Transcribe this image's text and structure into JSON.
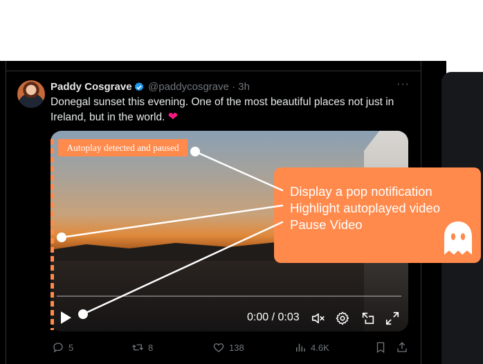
{
  "tweet": {
    "author_name": "Paddy Cosgrave",
    "handle_time": "@paddycosgrave · 3h",
    "more_glyph": "···",
    "text": "Donegal sunset this evening. One of the most beautiful places not just in Ireland, but in the world.",
    "heart_glyph": "❤"
  },
  "video": {
    "notice": "Autoplay detected and paused",
    "time": "0:00 / 0:03",
    "play_icon": "play-icon",
    "mute_icon": "muted-speaker-icon",
    "settings_icon": "gear-icon",
    "pip_icon": "picture-in-picture-icon",
    "fullscreen_icon": "expand-icon"
  },
  "popup": {
    "lines": [
      "Display a pop notification",
      "Highlight autoplayed video",
      "Pause Video"
    ],
    "mascot_icon": "ghost-icon"
  },
  "actions": {
    "replies": "5",
    "reposts": "8",
    "likes": "138",
    "views": "4.6K"
  },
  "colors": {
    "accent": "#ff8a4c",
    "background": "#000000",
    "text_primary": "#e7e9ea",
    "text_secondary": "#71767b",
    "verified": "#1d9bf0",
    "heart": "#f91880"
  }
}
